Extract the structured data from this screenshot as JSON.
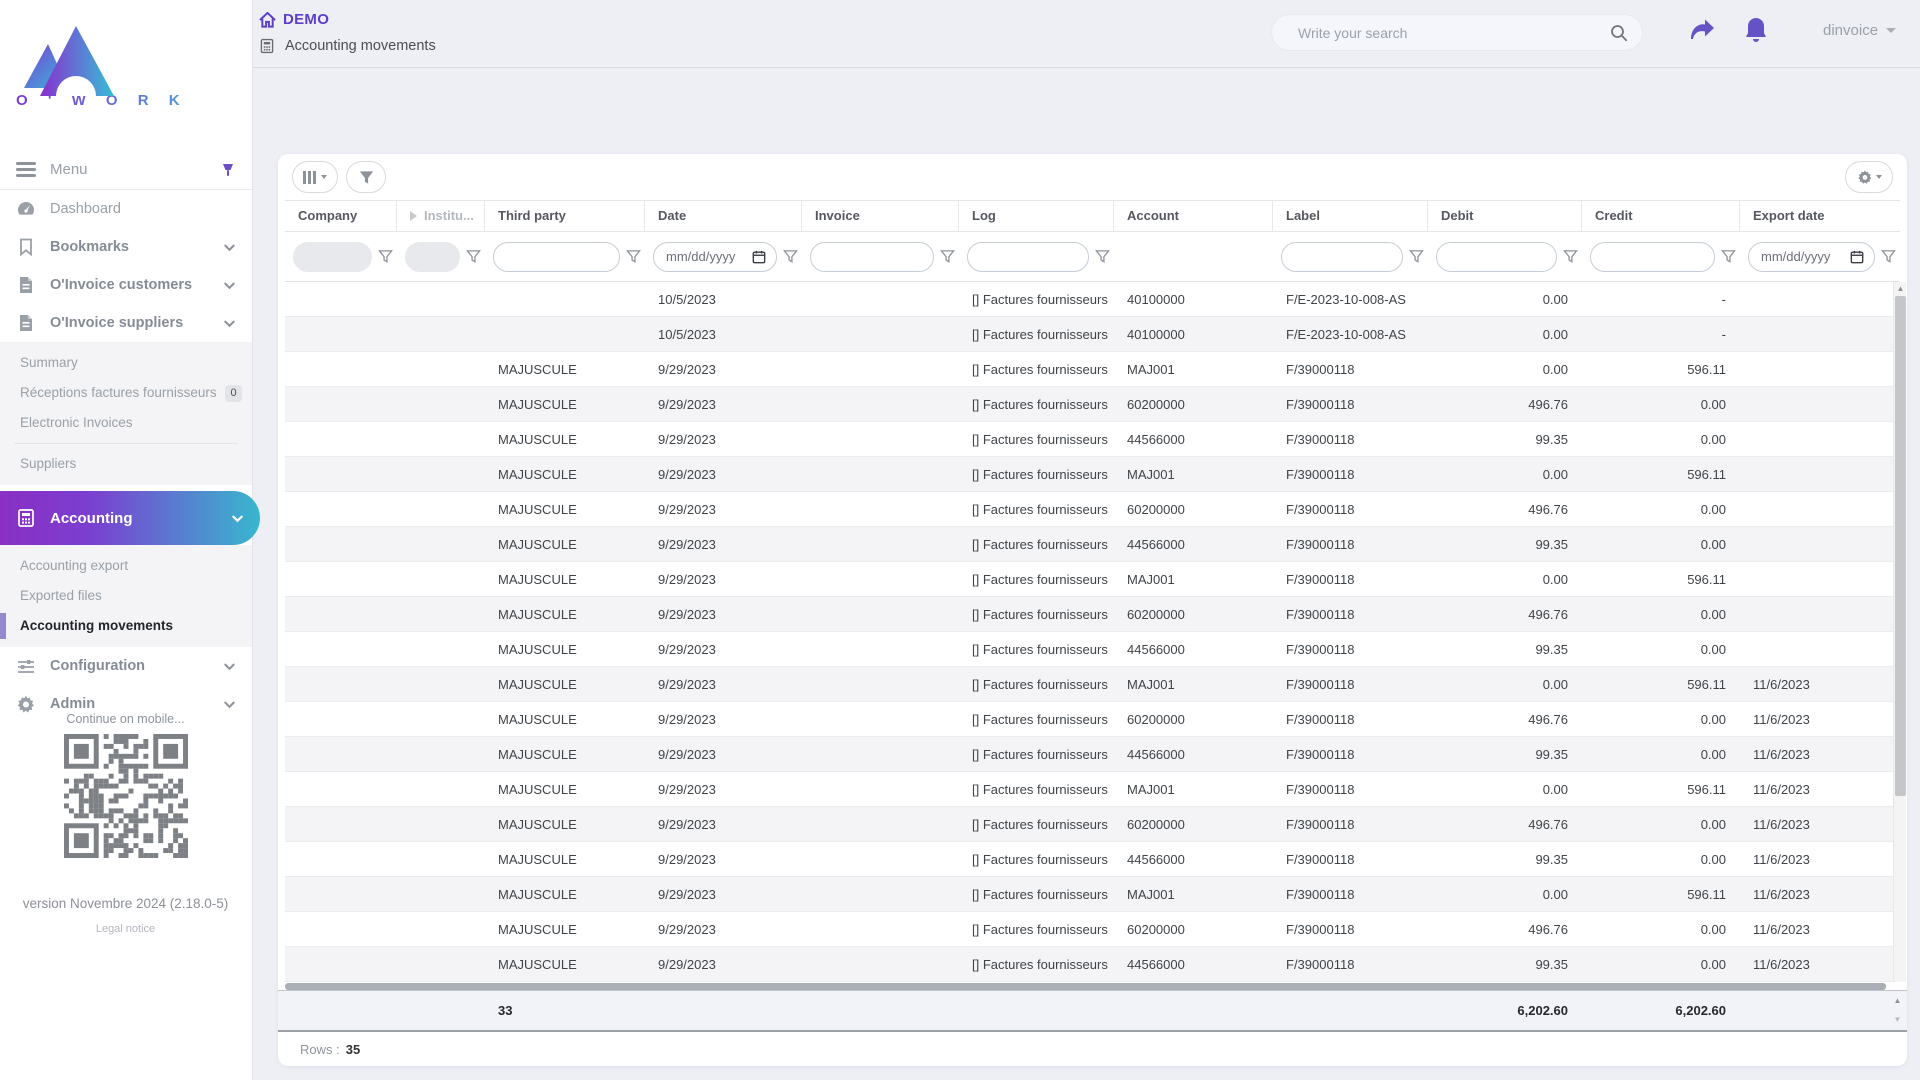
{
  "colors": {
    "accent": "#5b3fc8",
    "gradient_start": "#8a2fc4",
    "gradient_end": "#38b7cf",
    "sidebar_text": "#9aa0a8",
    "table_text": "#3f4449"
  },
  "sidebar": {
    "logo_text": "O ' W O R K",
    "menu_label": "Menu",
    "items": [
      {
        "label": "Dashboard"
      },
      {
        "label": "Bookmarks"
      },
      {
        "label": "O'Invoice customers"
      },
      {
        "label": "O'Invoice suppliers"
      },
      {
        "label": "Accounting"
      },
      {
        "label": "Configuration"
      },
      {
        "label": "Admin"
      }
    ],
    "suppliers_submenu": [
      {
        "label": "Summary"
      },
      {
        "label": "Réceptions factures fournisseurs",
        "badge": "0"
      },
      {
        "label": "Electronic Invoices"
      },
      {
        "label": "Suppliers",
        "divider_before": true
      }
    ],
    "accounting_submenu": [
      {
        "label": "Accounting export"
      },
      {
        "label": "Exported files"
      },
      {
        "label": "Accounting movements",
        "active": true
      }
    ],
    "mobile_hint": "Continue on mobile...",
    "version": "version Novembre 2024 (2.18.0-5)",
    "legal": "Legal notice"
  },
  "header": {
    "app_badge": "DEMO",
    "page_title": "Accounting movements",
    "search_placeholder": "Write your search",
    "user": "dinvoice"
  },
  "table": {
    "columns": [
      {
        "label": "Company",
        "filter": "disabled"
      },
      {
        "label": "Institu...",
        "filter": "disabled",
        "muted": true,
        "expand_icon": true
      },
      {
        "label": "Third party",
        "filter": "text"
      },
      {
        "label": "Date",
        "filter": "date"
      },
      {
        "label": "Invoice",
        "filter": "text"
      },
      {
        "label": "Log",
        "filter": "text"
      },
      {
        "label": "Account",
        "filter": "none"
      },
      {
        "label": "Label",
        "filter": "text"
      },
      {
        "label": "Debit",
        "filter": "text",
        "align": "right"
      },
      {
        "label": "Credit",
        "filter": "text",
        "align": "right"
      },
      {
        "label": "Export date",
        "filter": "date"
      }
    ],
    "date_placeholder": "mm/dd/yyyy",
    "rows": [
      [
        "",
        "10/5/2023",
        "[] Factures fournisseurs",
        "40100000",
        "F/E-2023-10-008-AS",
        "0.00",
        "-",
        ""
      ],
      [
        "",
        "10/5/2023",
        "[] Factures fournisseurs",
        "40100000",
        "F/E-2023-10-008-AS",
        "0.00",
        "-",
        ""
      ],
      [
        "MAJUSCULE",
        "9/29/2023",
        "[] Factures fournisseurs",
        "MAJ001",
        "F/39000118",
        "0.00",
        "596.11",
        ""
      ],
      [
        "MAJUSCULE",
        "9/29/2023",
        "[] Factures fournisseurs",
        "60200000",
        "F/39000118",
        "496.76",
        "0.00",
        ""
      ],
      [
        "MAJUSCULE",
        "9/29/2023",
        "[] Factures fournisseurs",
        "44566000",
        "F/39000118",
        "99.35",
        "0.00",
        ""
      ],
      [
        "MAJUSCULE",
        "9/29/2023",
        "[] Factures fournisseurs",
        "MAJ001",
        "F/39000118",
        "0.00",
        "596.11",
        ""
      ],
      [
        "MAJUSCULE",
        "9/29/2023",
        "[] Factures fournisseurs",
        "60200000",
        "F/39000118",
        "496.76",
        "0.00",
        ""
      ],
      [
        "MAJUSCULE",
        "9/29/2023",
        "[] Factures fournisseurs",
        "44566000",
        "F/39000118",
        "99.35",
        "0.00",
        ""
      ],
      [
        "MAJUSCULE",
        "9/29/2023",
        "[] Factures fournisseurs",
        "MAJ001",
        "F/39000118",
        "0.00",
        "596.11",
        ""
      ],
      [
        "MAJUSCULE",
        "9/29/2023",
        "[] Factures fournisseurs",
        "60200000",
        "F/39000118",
        "496.76",
        "0.00",
        ""
      ],
      [
        "MAJUSCULE",
        "9/29/2023",
        "[] Factures fournisseurs",
        "44566000",
        "F/39000118",
        "99.35",
        "0.00",
        ""
      ],
      [
        "MAJUSCULE",
        "9/29/2023",
        "[] Factures fournisseurs",
        "MAJ001",
        "F/39000118",
        "0.00",
        "596.11",
        "11/6/2023"
      ],
      [
        "MAJUSCULE",
        "9/29/2023",
        "[] Factures fournisseurs",
        "60200000",
        "F/39000118",
        "496.76",
        "0.00",
        "11/6/2023"
      ],
      [
        "MAJUSCULE",
        "9/29/2023",
        "[] Factures fournisseurs",
        "44566000",
        "F/39000118",
        "99.35",
        "0.00",
        "11/6/2023"
      ],
      [
        "MAJUSCULE",
        "9/29/2023",
        "[] Factures fournisseurs",
        "MAJ001",
        "F/39000118",
        "0.00",
        "596.11",
        "11/6/2023"
      ],
      [
        "MAJUSCULE",
        "9/29/2023",
        "[] Factures fournisseurs",
        "60200000",
        "F/39000118",
        "496.76",
        "0.00",
        "11/6/2023"
      ],
      [
        "MAJUSCULE",
        "9/29/2023",
        "[] Factures fournisseurs",
        "44566000",
        "F/39000118",
        "99.35",
        "0.00",
        "11/6/2023"
      ],
      [
        "MAJUSCULE",
        "9/29/2023",
        "[] Factures fournisseurs",
        "MAJ001",
        "F/39000118",
        "0.00",
        "596.11",
        "11/6/2023"
      ],
      [
        "MAJUSCULE",
        "9/29/2023",
        "[] Factures fournisseurs",
        "60200000",
        "F/39000118",
        "496.76",
        "0.00",
        "11/6/2023"
      ],
      [
        "MAJUSCULE",
        "9/29/2023",
        "[] Factures fournisseurs",
        "44566000",
        "F/39000118",
        "99.35",
        "0.00",
        "11/6/2023"
      ]
    ],
    "totals": {
      "count": "33",
      "debit": "6,202.60",
      "credit": "6,202.60"
    },
    "footer": {
      "rows_label": "Rows :",
      "rows_value": "35"
    }
  }
}
